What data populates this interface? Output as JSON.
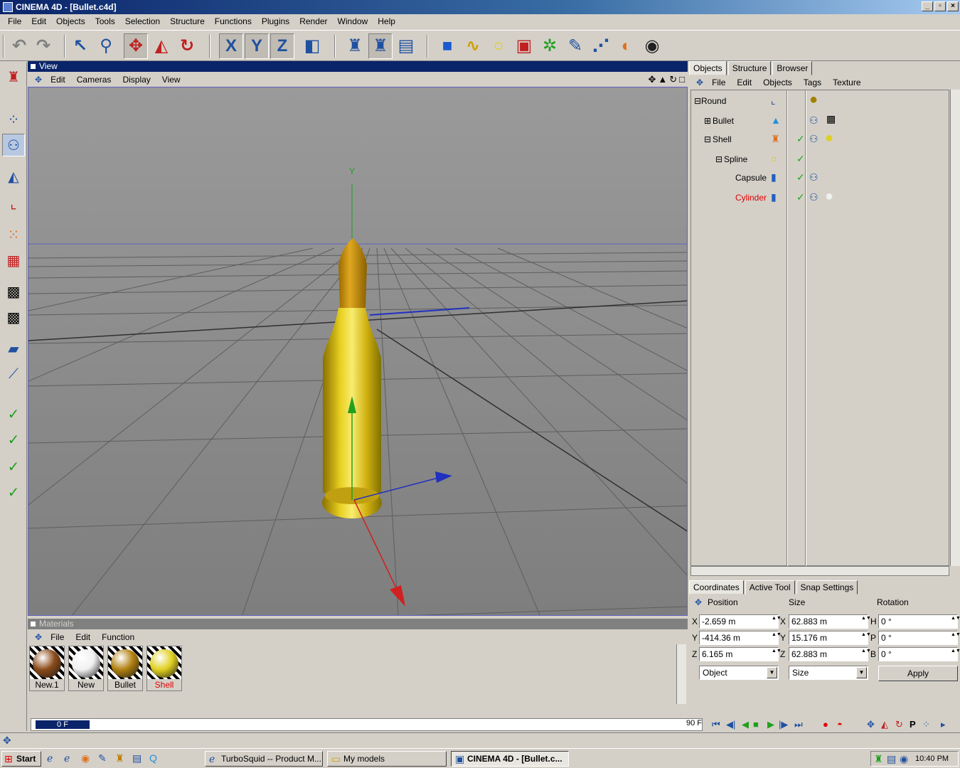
{
  "window": {
    "title": "CINEMA 4D - [Bullet.c4d]",
    "min": "_",
    "max": "▫",
    "close": "×"
  },
  "menu": [
    "File",
    "Edit",
    "Objects",
    "Tools",
    "Selection",
    "Structure",
    "Functions",
    "Plugins",
    "Render",
    "Window",
    "Help"
  ],
  "toolbar": {
    "axis_x": "X",
    "axis_y": "Y",
    "axis_z": "Z"
  },
  "view_panel": {
    "title": "View",
    "menu": [
      "Edit",
      "Cameras",
      "Display",
      "View"
    ],
    "axis_label_y": "Y"
  },
  "objects_panel": {
    "tabs": [
      "Objects",
      "Structure",
      "Browser"
    ],
    "menu": [
      "File",
      "Edit",
      "Objects",
      "Tags",
      "Texture"
    ],
    "tree": [
      {
        "label": "Round",
        "expander": "⊟"
      },
      {
        "label": "Bullet",
        "expander": "⊞"
      },
      {
        "label": "Shell",
        "expander": "⊟"
      },
      {
        "label": "Spline",
        "expander": "⊟"
      },
      {
        "label": "Capsule",
        "expander": ""
      },
      {
        "label": "Cylinder",
        "expander": ""
      }
    ],
    "checkmark": "✓"
  },
  "coordinates_panel": {
    "tabs": [
      "Coordinates",
      "Active Tool",
      "Snap Settings"
    ],
    "headers": {
      "position": "Position",
      "size": "Size",
      "rotation": "Rotation"
    },
    "rows": [
      {
        "pos_axis": "X",
        "pos": "-2.659 m",
        "size_axis": "X",
        "size": "62.883 m",
        "rot_axis": "H",
        "rot": "0 °"
      },
      {
        "pos_axis": "Y",
        "pos": "-414.36 m",
        "size_axis": "Y",
        "size": "15.176 m",
        "rot_axis": "P",
        "rot": "0 °"
      },
      {
        "pos_axis": "Z",
        "pos": "6.165 m",
        "size_axis": "Z",
        "size": "62.883 m",
        "rot_axis": "B",
        "rot": "0 °"
      }
    ],
    "mode_select": "Object",
    "size_select": "Size",
    "apply": "Apply"
  },
  "materials_panel": {
    "title": "Materials",
    "menu": [
      "File",
      "Edit",
      "Function"
    ],
    "items": [
      {
        "name": "New.1",
        "color": "#8a4a1a"
      },
      {
        "name": "New",
        "color": "#f0f0f0"
      },
      {
        "name": "Bullet",
        "color": "#b08010"
      },
      {
        "name": "Shell",
        "color": "#e0d020"
      }
    ]
  },
  "timeline": {
    "current": "0 F",
    "end": "90 F"
  },
  "taskbar": {
    "start": "Start",
    "tasks": [
      "TurboSquid -- Product M...",
      "My models",
      "CINEMA 4D - [Bullet.c..."
    ],
    "clock": "10:40 PM"
  },
  "colors": {
    "selection_text": "#e00000",
    "title_blue": "#0a246a",
    "bullet_gold": "#d4b010"
  }
}
